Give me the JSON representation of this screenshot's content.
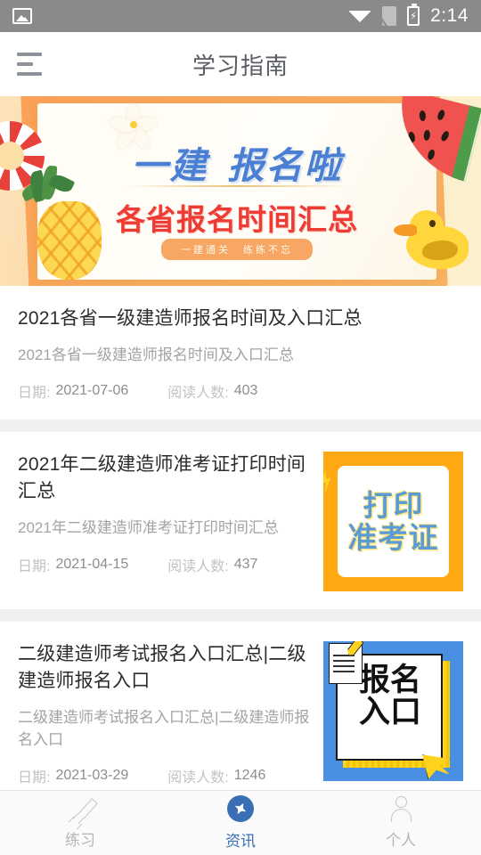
{
  "status_bar": {
    "time": "2:14",
    "icons": [
      "image-icon",
      "wifi-icon",
      "sim-card-off-icon",
      "battery-charging-icon"
    ],
    "battery_glyph": "⚡",
    "background_color": "#8a8a8a"
  },
  "app_bar": {
    "menu_icon": "hamburger-menu-icon",
    "title": "学习指南"
  },
  "banner": {
    "headline": "一建",
    "headline2": "报名啦",
    "subhead": "各省报名时间汇总",
    "badge": "一建通关　练练不忘",
    "decorations": [
      "lifebuoy-icon",
      "pineapple-icon",
      "flower-icon",
      "watermelon-icon",
      "duck-icon"
    ],
    "colors": {
      "headline": "#4a7fd4",
      "subhead": "#ee3b33",
      "badge_bg": "#f7a763",
      "card_tilt": "#f9a157"
    }
  },
  "list": {
    "meta_date_label": "日期:",
    "meta_reads_label": "阅读人数:",
    "items": [
      {
        "title": "2021各省一级建造师报名时间及入口汇总",
        "desc": "2021各省一级建造师报名时间及入口汇总",
        "date": "2021-07-06",
        "reads": "403",
        "thumb": "none"
      },
      {
        "title": "2021年二级建造师准考证打印时间汇总",
        "desc": "2021年二级建造师准考证打印时间汇总",
        "date": "2021-04-15",
        "reads": "437",
        "thumb": "print-admission-ticket",
        "thumb_line1": "打印",
        "thumb_line2": "准考证",
        "thumb_bg": "#ffa811",
        "thumb_text_color": "#5b9bd5"
      },
      {
        "title": "二级建造师考试报名入口汇总|二级建造师报名入口",
        "desc": "二级建造师考试报名入口汇总|二级建造师报名入口",
        "date": "2021-03-29",
        "reads": "1246",
        "thumb": "registration-entry",
        "thumb_line1": "报名",
        "thumb_line2": "入口",
        "thumb_bg": "#4a90e2",
        "thumb_text_color": "#111111"
      }
    ]
  },
  "bottom_nav": {
    "active_color": "#3a6fb5",
    "inactive_color": "#b5b5b5",
    "items": [
      {
        "label": "练习",
        "icon": "pencil-icon",
        "active": false
      },
      {
        "label": "资讯",
        "icon": "compass-icon",
        "active": true
      },
      {
        "label": "个人",
        "icon": "person-icon",
        "active": false
      }
    ]
  }
}
